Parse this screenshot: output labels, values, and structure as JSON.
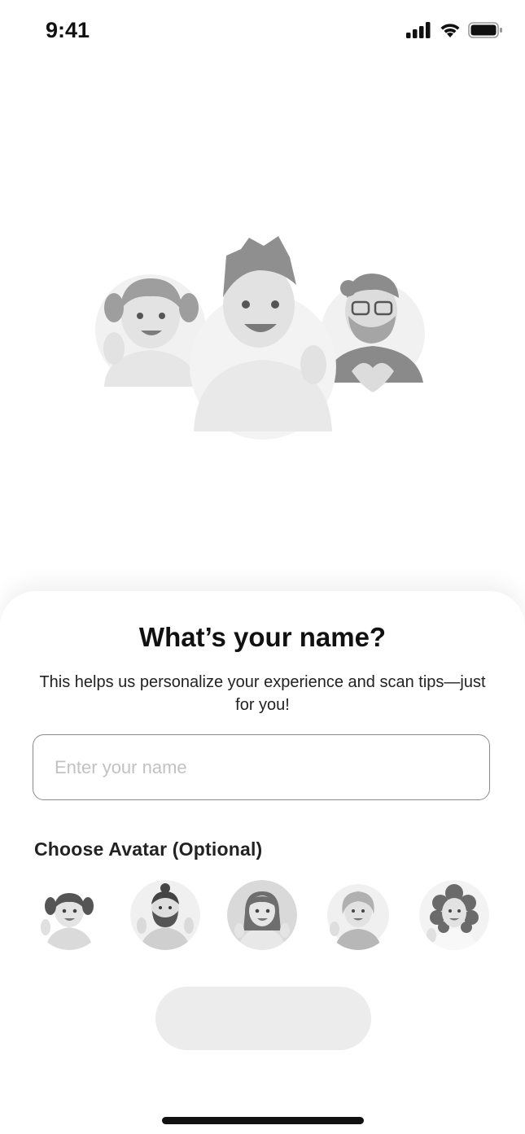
{
  "status_bar": {
    "time": "9:41",
    "icons": [
      "cellular-signal-icon",
      "wifi-icon",
      "battery-icon"
    ]
  },
  "hero": {
    "illustration": "family-avatars-illustration",
    "people": [
      "girl-with-pigtails-waving",
      "boy-in-hoodie-waving",
      "bearded-man-heart-hands"
    ]
  },
  "sheet": {
    "title": "What’s your name?",
    "subtitle": "This helps us personalize your experience and scan tips—just for you!",
    "name_input": {
      "value": "",
      "placeholder": "Enter your name"
    },
    "avatar_section_label": "Choose Avatar (Optional)",
    "avatar_options": [
      {
        "id": "girl-pigtails"
      },
      {
        "id": "man-beard-bun"
      },
      {
        "id": "girl-pigtails-long"
      },
      {
        "id": "older-woman"
      },
      {
        "id": "woman-curly-hair"
      }
    ],
    "continue_button": {
      "label": ""
    }
  },
  "colors": {
    "background": "#ffffff",
    "text": "#111111",
    "placeholder": "#c2c2c2",
    "input_border": "#8a8a8a",
    "button_disabled": "#ececec"
  }
}
